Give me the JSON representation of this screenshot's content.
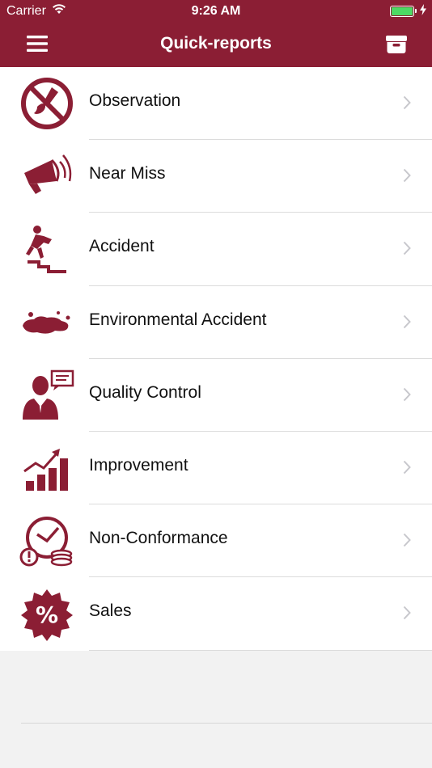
{
  "status_bar": {
    "carrier": "Carrier",
    "time": "9:26 AM"
  },
  "nav": {
    "title": "Quick-reports"
  },
  "colors": {
    "brand": "#8b1e34",
    "chevron": "#c7c7cc",
    "separator": "#dcdcdc"
  },
  "items": [
    {
      "label": "Observation",
      "icon": "no-brush-icon"
    },
    {
      "label": "Near Miss",
      "icon": "megaphone-icon"
    },
    {
      "label": "Accident",
      "icon": "falling-person-icon"
    },
    {
      "label": "Environmental Accident",
      "icon": "spill-icon"
    },
    {
      "label": "Quality Control",
      "icon": "speaking-person-icon"
    },
    {
      "label": "Improvement",
      "icon": "growth-chart-icon"
    },
    {
      "label": "Non-Conformance",
      "icon": "clock-alert-coins-icon"
    },
    {
      "label": "Sales",
      "icon": "percent-badge-icon"
    }
  ]
}
